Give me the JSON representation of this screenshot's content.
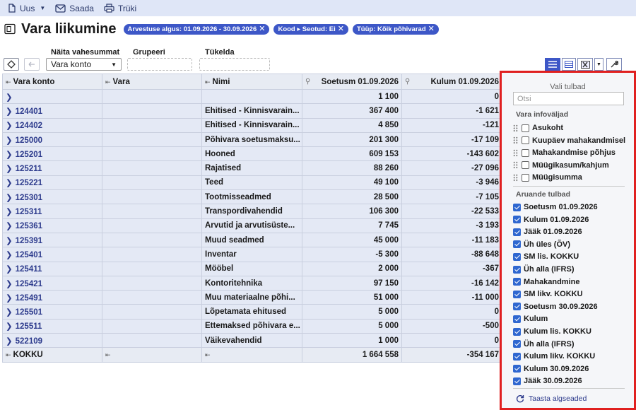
{
  "toolbar": {
    "new_label": "Uus",
    "send_label": "Saada",
    "print_label": "Trüki"
  },
  "header": {
    "title": "Vara liikumine",
    "filters": [
      "Arvestuse algus: 01.09.2026 - 30.09.2026",
      "Kood ▸ Seotud: Ei",
      "Tüüp: Kõik põhivarad"
    ]
  },
  "controls": {
    "subtotal_label": "Näita vahesummat",
    "subtotal_value": "Vara konto",
    "group_label": "Grupeeri",
    "split_label": "Tükelda"
  },
  "table": {
    "columns": [
      "Vara konto",
      "Vara",
      "Nimi",
      "Soetusm 01.09.2026",
      "Kulum 01.09.2026"
    ],
    "rows": [
      {
        "code": "",
        "vara": "",
        "name": "",
        "soetus": "1 100",
        "kulum": "0"
      },
      {
        "code": "124401",
        "vara": "",
        "name": "Ehitised - Kinnisvarain...",
        "soetus": "367 400",
        "kulum": "-1 621"
      },
      {
        "code": "124402",
        "vara": "",
        "name": "Ehitised - Kinnisvarain...",
        "soetus": "4 850",
        "kulum": "-121"
      },
      {
        "code": "125000",
        "vara": "",
        "name": "Põhivara soetusmaksu...",
        "soetus": "201 300",
        "kulum": "-17 109"
      },
      {
        "code": "125201",
        "vara": "",
        "name": "Hooned",
        "soetus": "609 153",
        "kulum": "-143 602"
      },
      {
        "code": "125211",
        "vara": "",
        "name": "Rajatised",
        "soetus": "88 260",
        "kulum": "-27 096"
      },
      {
        "code": "125221",
        "vara": "",
        "name": "Teed",
        "soetus": "49 100",
        "kulum": "-3 946"
      },
      {
        "code": "125301",
        "vara": "",
        "name": "Tootmisseadmed",
        "soetus": "28 500",
        "kulum": "-7 105"
      },
      {
        "code": "125311",
        "vara": "",
        "name": "Transpordivahendid",
        "soetus": "106 300",
        "kulum": "-22 533"
      },
      {
        "code": "125361",
        "vara": "",
        "name": "Arvutid ja arvutisüste...",
        "soetus": "7 745",
        "kulum": "-3 193"
      },
      {
        "code": "125391",
        "vara": "",
        "name": "Muud seadmed",
        "soetus": "45 000",
        "kulum": "-11 183"
      },
      {
        "code": "125401",
        "vara": "",
        "name": "Inventar",
        "soetus": "-5 300",
        "kulum": "-88 648"
      },
      {
        "code": "125411",
        "vara": "",
        "name": "Mööbel",
        "soetus": "2 000",
        "kulum": "-367"
      },
      {
        "code": "125421",
        "vara": "",
        "name": "Kontoritehnika",
        "soetus": "97 150",
        "kulum": "-16 142"
      },
      {
        "code": "125491",
        "vara": "",
        "name": "Muu materiaalne põhi...",
        "soetus": "51 000",
        "kulum": "-11 000"
      },
      {
        "code": "125501",
        "vara": "",
        "name": "Lõpetamata ehitused",
        "soetus": "5 000",
        "kulum": "0"
      },
      {
        "code": "125511",
        "vara": "",
        "name": "Ettemaksed põhivara e...",
        "soetus": "5 000",
        "kulum": "-500"
      },
      {
        "code": "522109",
        "vara": "",
        "name": "Väikevahendid",
        "soetus": "1 000",
        "kulum": "0"
      }
    ],
    "total": {
      "label": "KOKKU",
      "soetus": "1 664 558",
      "kulum": "-354 167"
    }
  },
  "panel": {
    "title": "Vali tulbad",
    "search_placeholder": "Otsi",
    "info_section": "Vara infoväljad",
    "info_items": [
      "Asukoht",
      "Kuupäev mahakandmisel",
      "Mahakandmise põhjus",
      "Müügikasum/kahjum",
      "Müügisumma"
    ],
    "report_section": "Aruande tulbad",
    "report_items": [
      "Soetusm 01.09.2026",
      "Kulum 01.09.2026",
      "Jääk 01.09.2026",
      "Üh üles (ÕV)",
      "SM lis. KOKKU",
      "Üh alla (IFRS)",
      "Mahakandmine",
      "SM likv. KOKKU",
      "Soetusm 30.09.2026",
      "Kulum",
      "Kulum lis. KOKKU",
      "Üh alla (IFRS)",
      "Kulum likv. KOKKU",
      "Kulum 30.09.2026",
      "Jääk 30.09.2026"
    ],
    "reset_label": "Taasta algseaded"
  },
  "colors": {
    "accent": "#3d57c7",
    "highlight_border": "#e02020",
    "row_bg": "#e4e9f5"
  }
}
